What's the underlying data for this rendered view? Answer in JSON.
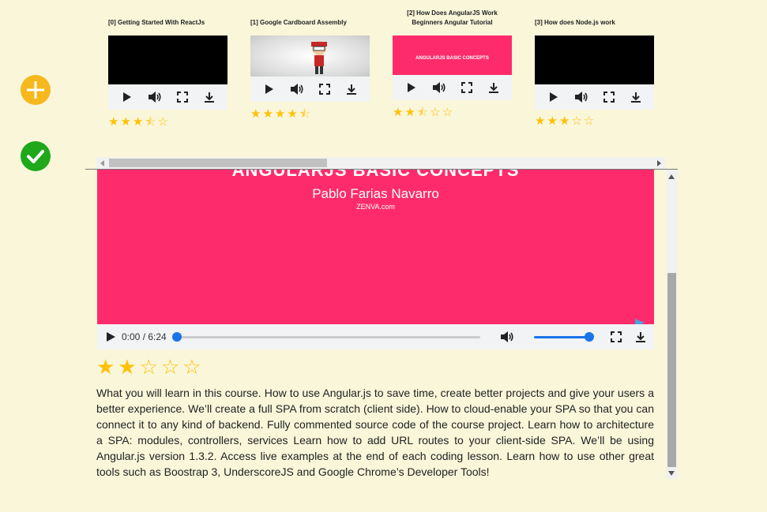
{
  "sidebar": {
    "add_icon": "plus-circle-icon",
    "done_icon": "check-circle-icon",
    "colors": {
      "add": "#f6b81d",
      "done": "#1ea81a"
    }
  },
  "videos": [
    {
      "title": "[0] Getting Started With ReactJs",
      "rating": 3.5
    },
    {
      "title": "[1] Google Cardboard Assembly",
      "rating": 4.5
    },
    {
      "title": "[2] How Does AngularJS Work Beginners Angular Tutorial",
      "thumb_text": "ANGULARJS BASIC CONCEPTS",
      "rating": 2.5
    },
    {
      "title": "[3] How does Node.js work",
      "rating": 3
    }
  ],
  "main": {
    "thumb_title": "ANGULARJS BASIC CONCEPTS",
    "author": "Pablo Farias Navarro",
    "org": "ZENVA.com",
    "time": "0:00 / 6:24",
    "progress": 0,
    "volume": 1,
    "rating": 2,
    "description": "What you will learn in this course. How to use Angular.js to save time, create better projects and give your users a better experience. We’ll create a full SPA from scratch (client side). How to cloud-enable your SPA so that you can connect it to any kind of backend. Fully commented source code of the course project. Learn how to architecture a SPA: modules, controllers, services Learn how to add URL routes to your client-side SPA. We’ll be using Angular.js version 1.3.2. Access live examples at the end of each coding lesson. Learn how to use other great tools such as Boostrap 3, UnderscoreJS and Google Chrome’s Developer Tools!"
  },
  "colors": {
    "accent": "#1a73e8",
    "star": "#ffc107",
    "main_thumb": "#fe2b6c"
  }
}
